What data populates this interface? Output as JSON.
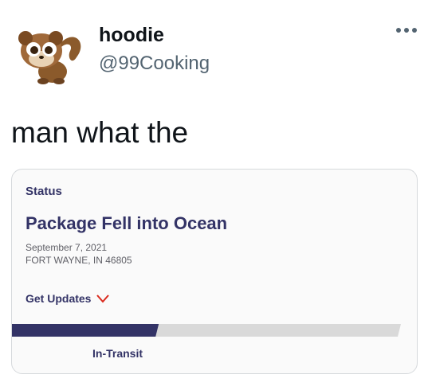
{
  "tweet": {
    "display_name": "hoodie",
    "handle": "@99Cooking",
    "text": "man what the",
    "avatar_icon": "cartoon-lemur-icon",
    "more_icon": "ellipsis-icon"
  },
  "tracking_card": {
    "status_label": "Status",
    "status_title": "Package Fell into Ocean",
    "date": "September 7, 2021",
    "location": "FORT WAYNE, IN 46805",
    "get_updates_label": "Get Updates",
    "get_updates_icon": "chevron-down-icon",
    "progress_fraction": 0.38,
    "progress_stage": "In-Transit",
    "colors": {
      "brand": "#333366",
      "chevron": "#da291c",
      "track": "#d9d9d9"
    }
  }
}
